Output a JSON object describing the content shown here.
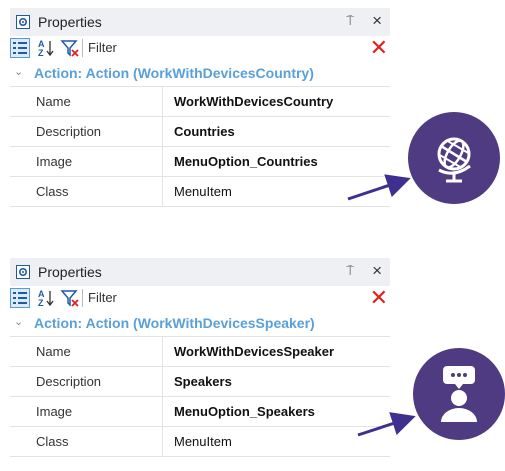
{
  "panels": [
    {
      "title": "Properties",
      "pin_glyph": "⍑",
      "close_glyph": "×",
      "filter_label": "Filter",
      "filter_value": "",
      "clear_glyph": "✕",
      "section_title": "Action: Action (WorkWithDevicesCountry)",
      "rows": [
        {
          "key": "Name",
          "value": "WorkWithDevicesCountry"
        },
        {
          "key": "Description",
          "value": "Countries"
        },
        {
          "key": "Image",
          "value": "MenuOption_Countries"
        },
        {
          "key": "Class",
          "value": "MenuItem"
        }
      ],
      "image_icon": "globe-icon"
    },
    {
      "title": "Properties",
      "pin_glyph": "⍑",
      "close_glyph": "×",
      "filter_label": "Filter",
      "filter_value": "",
      "clear_glyph": "✕",
      "section_title": "Action: Action (WorkWithDevicesSpeaker)",
      "rows": [
        {
          "key": "Name",
          "value": "WorkWithDevicesSpeaker"
        },
        {
          "key": "Description",
          "value": "Speakers"
        },
        {
          "key": "Image",
          "value": "MenuOption_Speakers"
        },
        {
          "key": "Class",
          "value": "MenuItem"
        }
      ],
      "image_icon": "speaker-icon"
    }
  ],
  "colors": {
    "accent": "#5aa0d8",
    "circle": "#4e3b82",
    "arrow": "#3f2f8f",
    "clear": "#e02020"
  }
}
